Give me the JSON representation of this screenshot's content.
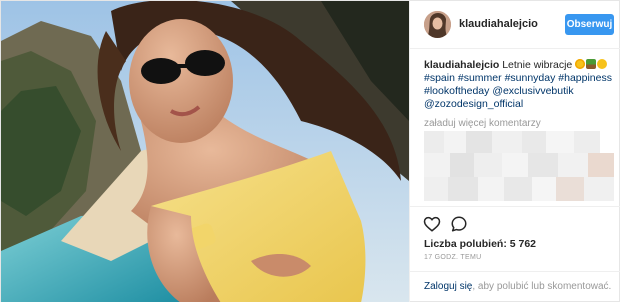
{
  "post": {
    "username": "klaudiahalejcio",
    "follow_label": "Obserwuj",
    "caption": {
      "user": "klaudiahalejcio",
      "text": "Letnie wibracje",
      "emoji_icons": [
        "sun-emoji-icon",
        "palm-tree-emoji-icon",
        "smile-emoji-icon"
      ],
      "tags": [
        "#spain",
        "#summer",
        "#sunnyday",
        "#happiness",
        "#lookoftheday",
        "@exclusivvebutik",
        "@zozodesign_official"
      ]
    },
    "load_more_label": "załaduj więcej komentarzy",
    "likes_label": "Liczba polubień: 5 762",
    "time_label": "17 GODZ. TEMU",
    "login_link": "Zaloguj się",
    "login_text": ", aby polubić lub skomentować.",
    "icons": {
      "like": "heart-icon",
      "comment": "comment-icon"
    },
    "colors": {
      "accent": "#3897f0",
      "link": "#003569",
      "muted": "#999999",
      "border": "#efefef"
    }
  }
}
